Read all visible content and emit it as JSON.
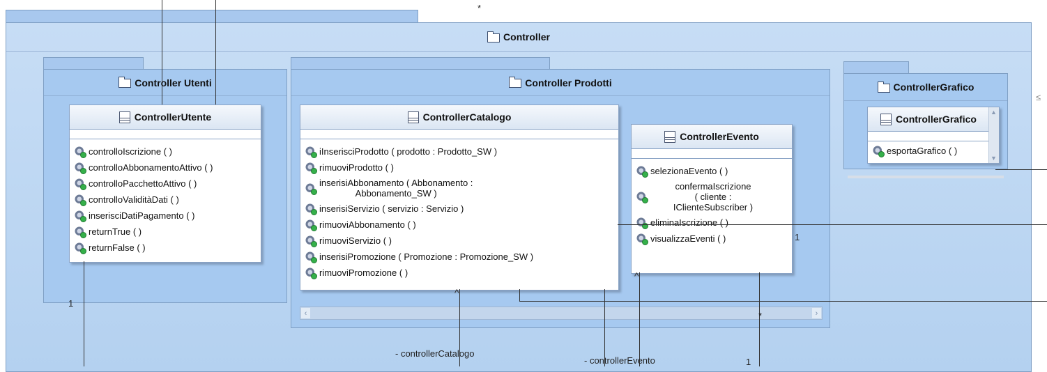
{
  "packages": {
    "controller": {
      "name": "Controller"
    },
    "utenti": {
      "name": "Controller Utenti"
    },
    "prodotti": {
      "name": "Controller Prodotti"
    },
    "grafico": {
      "name": "ControllerGrafico"
    }
  },
  "classes": {
    "utente": {
      "name": "ControllerUtente",
      "operations": [
        "controlloIscrizione ( )",
        "controlloAbbonamentoAttivo ( )",
        "controlloPacchettoAttivo ( )",
        "controlloValiditàDati ( )",
        "inserisciDatiPagamento ( )",
        "returnTrue ( )",
        "returnFalse ( )"
      ]
    },
    "catalogo": {
      "name": "ControllerCatalogo",
      "operations": [
        "iInserisciProdotto ( prodotto : Prodotto_SW )",
        "rimuoviProdotto ( )",
        "inserisiAbbonamento ( Abbonamento :\nAbbonamento_SW )",
        "inserisiServizio ( servizio : Servizio )",
        "rimuoviAbbonamento ( )",
        "rimuoviServizio ( )",
        "inserisiPromozione ( Promozione : Promozione_SW )",
        "rimuoviPromozione ( )"
      ]
    },
    "evento": {
      "name": "ControllerEvento",
      "operations": [
        "selezionaEvento ( )",
        "confermaIscrizione\n( cliente :\nIClienteSubscriber )",
        "eliminaIscrizione ( )",
        "visualizzaEventi ( )"
      ]
    },
    "grafico": {
      "name": "ControllerGrafico",
      "operations": [
        "esportaGrafico ( )"
      ]
    }
  },
  "labels": {
    "star_top": "*",
    "mult_utenti": "1",
    "mult_evento_right": "1",
    "star_bottom": "*",
    "role_catalogo": "- controllerCatalogo",
    "role_evento": "- controllerEvento",
    "mult_bottom": "1",
    "arrow_right": "≤"
  }
}
